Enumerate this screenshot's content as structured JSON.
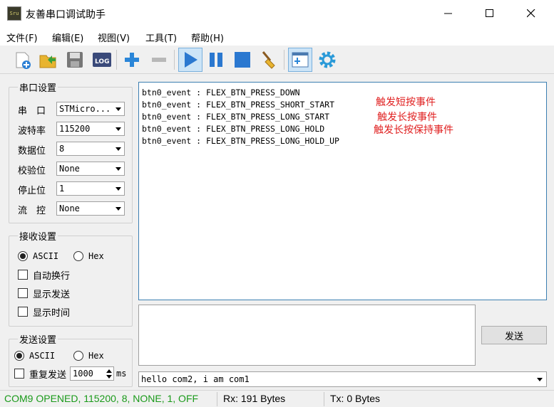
{
  "window": {
    "title": "友善串口调试助手",
    "icon_text": "Sru"
  },
  "menu": [
    {
      "label": "文件(F)"
    },
    {
      "label": "编辑(E)"
    },
    {
      "label": "视图(V)"
    },
    {
      "label": "工具(T)"
    },
    {
      "label": "帮助(H)"
    }
  ],
  "serial": {
    "title": "串口设置",
    "port_label": "串　口",
    "port": "STMicro...",
    "baud_label": "波特率",
    "baud": "115200",
    "databits_label": "数据位",
    "databits": "8",
    "parity_label": "校验位",
    "parity": "None",
    "stopbits_label": "停止位",
    "stopbits": "1",
    "flow_label": "流　控",
    "flow": "None"
  },
  "receive": {
    "title": "接收设置",
    "ascii": "ASCII",
    "hex": "Hex",
    "selected": "ASCII",
    "auto_wrap": "自动换行",
    "show_send": "显示发送",
    "show_time": "显示时间"
  },
  "send": {
    "title": "发送设置",
    "ascii": "ASCII",
    "hex": "Hex",
    "selected": "ASCII",
    "repeat": "重复发送",
    "interval": "1000",
    "unit": "ms",
    "button": "发送"
  },
  "rx_lines": [
    "btn0_event : FLEX_BTN_PRESS_DOWN",
    "btn0_event : FLEX_BTN_PRESS_SHORT_START",
    "btn0_event : FLEX_BTN_PRESS_LONG_START",
    "btn0_event : FLEX_BTN_PRESS_LONG_HOLD",
    "btn0_event : FLEX_BTN_PRESS_LONG_HOLD_UP"
  ],
  "annotations": [
    "触发短按事件",
    "触发长按事件",
    "触发长按保持事件"
  ],
  "history": "hello com2, i am com1",
  "status": {
    "port": "COM9 OPENED, 115200, 8, NONE, 1, OFF",
    "rx": "Rx: 191 Bytes",
    "tx": "Tx: 0 Bytes"
  },
  "colors": {
    "status_ok": "#1a9a1a",
    "annotation": "#e02020",
    "rx_border": "#3c7fb1",
    "toolbar_active": "#cce4f7"
  }
}
